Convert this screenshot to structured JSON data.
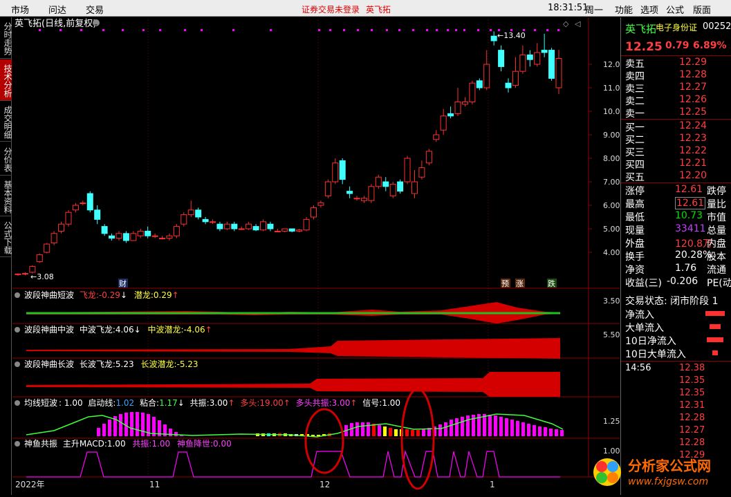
{
  "menubar": {
    "items": [
      "市场",
      "问达",
      "交易"
    ],
    "warning": "证券交易未登录",
    "stock": "英飞拓",
    "time": "18:31:51",
    "weekday": "周一",
    "right": [
      "功能",
      "选项",
      "公式",
      "版面"
    ]
  },
  "sidebar": {
    "tabs": [
      "分时走势",
      "技术分析",
      "成交明细",
      "分价表",
      "基本资料",
      "公式下载"
    ],
    "active": 1
  },
  "main_chart": {
    "title": "英飞拓(日线,前复权)",
    "high_label": "13.40",
    "low_label": "3.08",
    "markers": [
      "财",
      "预",
      "涨",
      "跌"
    ],
    "yaxis": [
      "12.00",
      "11.00",
      "10.00",
      "9.00",
      "8.00",
      "7.00",
      "6.00",
      "5.00",
      "4.00"
    ],
    "xaxis": [
      "2022年",
      "11",
      "12",
      "1"
    ]
  },
  "panels": [
    {
      "name": "波段神曲短波",
      "items": [
        {
          "label": "飞龙:",
          "value": "-0.29",
          "arrow": "↓"
        },
        {
          "label": "潜龙:",
          "value": "0.29",
          "arrow": "↑"
        }
      ],
      "axis": "3.50"
    },
    {
      "name": "波段神曲中波",
      "items": [
        {
          "label": "中波飞龙:",
          "value": "4.06",
          "arrow": "↓"
        },
        {
          "label": "中波潜龙:",
          "value": "-4.06",
          "arrow": "↑"
        }
      ],
      "axis": "5.50"
    },
    {
      "name": "波段神曲长波",
      "items": [
        {
          "label": "长波飞龙:",
          "value": "5.23",
          "arrow": ""
        },
        {
          "label": "长波潜龙:",
          "value": "-5.23",
          "arrow": ""
        }
      ],
      "axis": ""
    },
    {
      "name": "均线短波",
      "items": [
        {
          "label": "",
          "value": ": 1.00",
          "arrow": ""
        },
        {
          "label": "启动线:",
          "value": "1.02",
          "arrow": ""
        },
        {
          "label": "粘合:",
          "value": "1.17",
          "arrow": "↓"
        },
        {
          "label": "共振:",
          "value": "3.00",
          "arrow": "↑"
        },
        {
          "label": "多头:",
          "value": "19.00",
          "arrow": "↑"
        },
        {
          "label": "多头共振:",
          "value": "3.00",
          "arrow": "↑"
        },
        {
          "label": "信号:",
          "value": "1.00",
          "arrow": ""
        }
      ],
      "axis": "1.25"
    },
    {
      "name": "神鱼共振",
      "items": [
        {
          "label": "主升MACD:",
          "value": "1.00",
          "arrow": ""
        },
        {
          "label": "共振:",
          "value": "1.00",
          "arrow": ""
        },
        {
          "label": "神鱼降世:",
          "value": "0.00",
          "arrow": ""
        }
      ],
      "axis": "1.00"
    }
  ],
  "quote": {
    "name": "英飞拓",
    "sub": "电子身份证",
    "code": "00252",
    "price": "12.25",
    "change": "0.79",
    "pct": "6.89%",
    "sell": [
      {
        "label": "卖五",
        "price": "12.29"
      },
      {
        "label": "卖四",
        "price": "12.28"
      },
      {
        "label": "卖三",
        "price": "12.27"
      },
      {
        "label": "卖二",
        "price": "12.26"
      },
      {
        "label": "卖一",
        "price": "12.25"
      }
    ],
    "buy": [
      {
        "label": "买一",
        "price": "12.24"
      },
      {
        "label": "买二",
        "price": "12.23"
      },
      {
        "label": "买三",
        "price": "12.22"
      },
      {
        "label": "买四",
        "price": "12.21"
      },
      {
        "label": "买五",
        "price": "12.20"
      }
    ],
    "stats": [
      {
        "l": "涨停",
        "v": "12.61",
        "r": "跌停",
        "vc": "#ff4040"
      },
      {
        "l": "最高",
        "v": "12.61",
        "r": "量比",
        "vc": "#ff4040",
        "box": true
      },
      {
        "l": "最低",
        "v": "10.73",
        "r": "市值",
        "vc": "#00e000"
      },
      {
        "l": "现量",
        "v": "33411",
        "r": "总量",
        "vc": "#c040ff"
      },
      {
        "l": "外盘",
        "v": "120.8万",
        "r": "内盘",
        "vc": "#ff4040"
      },
      {
        "l": "换手",
        "v": "20.28%",
        "r": "股本",
        "vc": "#fff"
      },
      {
        "l": "净资",
        "v": "1.76",
        "r": "流通",
        "vc": "#fff"
      },
      {
        "l": "收益(三)",
        "v": "-0.206",
        "r": "PE(动",
        "vc": "#fff"
      }
    ],
    "status": "交易状态: 闭市阶段 1",
    "flows": [
      "净流入",
      "大单流入",
      "10日净流入",
      "10日大单流入"
    ],
    "ticks_time": "14:56",
    "ticks": [
      "12.38",
      "12.35",
      "12.35",
      "12.31",
      "12.28",
      "12.27",
      "12.28",
      "12.29"
    ]
  },
  "logo": {
    "title": "分析家公式网",
    "url": "www.fxjgsw.com"
  },
  "chart_data": {
    "type": "candlestick",
    "candles": [
      [
        3.05,
        3.08,
        3.0,
        3.1
      ],
      [
        3.08,
        3.1,
        3.02,
        3.15
      ],
      [
        3.15,
        3.4,
        3.1,
        3.45
      ],
      [
        3.6,
        3.9,
        3.55,
        3.95
      ],
      [
        4.0,
        4.35,
        3.95,
        4.4
      ],
      [
        4.4,
        4.8,
        4.3,
        4.9
      ],
      [
        4.9,
        5.2,
        4.8,
        5.3
      ],
      [
        5.2,
        5.7,
        5.1,
        5.8
      ],
      [
        5.8,
        6.0,
        5.7,
        6.1
      ],
      [
        6.1,
        6.1,
        6.0,
        6.2
      ],
      [
        6.5,
        5.8,
        5.7,
        6.6
      ],
      [
        5.8,
        5.4,
        5.2,
        6.0
      ],
      [
        5.1,
        4.8,
        4.7,
        5.2
      ],
      [
        4.7,
        4.6,
        4.5,
        4.8
      ],
      [
        4.6,
        4.8,
        4.5,
        4.9
      ],
      [
        4.8,
        4.5,
        4.4,
        4.9
      ],
      [
        4.5,
        4.8,
        4.5,
        4.9
      ],
      [
        4.7,
        4.9,
        4.6,
        5.0
      ],
      [
        4.9,
        4.7,
        4.6,
        5.1
      ],
      [
        4.7,
        4.7,
        4.6,
        4.8
      ],
      [
        4.6,
        4.6,
        4.55,
        4.7
      ],
      [
        4.6,
        4.7,
        4.5,
        4.8
      ],
      [
        4.7,
        5.1,
        4.6,
        5.2
      ],
      [
        5.2,
        5.6,
        5.1,
        5.7
      ],
      [
        5.6,
        5.8,
        5.5,
        6.2
      ],
      [
        5.8,
        5.5,
        5.4,
        5.9
      ],
      [
        5.4,
        5.3,
        5.2,
        5.5
      ],
      [
        5.3,
        5.3,
        5.2,
        5.4
      ],
      [
        5.2,
        5.0,
        4.9,
        5.3
      ],
      [
        5.0,
        5.2,
        4.95,
        5.3
      ],
      [
        5.2,
        5.0,
        4.9,
        5.3
      ],
      [
        5.0,
        5.0,
        4.95,
        5.1
      ],
      [
        5.0,
        5.2,
        4.95,
        5.3
      ],
      [
        5.1,
        4.95,
        4.9,
        5.2
      ],
      [
        4.95,
        5.3,
        4.9,
        5.4
      ],
      [
        5.2,
        5.0,
        4.9,
        5.3
      ],
      [
        4.9,
        4.9,
        4.85,
        5.0
      ],
      [
        4.9,
        5.0,
        4.85,
        5.0
      ],
      [
        5.0,
        4.9,
        4.85,
        5.0
      ],
      [
        4.9,
        4.95,
        4.85,
        5.0
      ],
      [
        4.95,
        5.4,
        4.9,
        5.5
      ],
      [
        5.5,
        5.9,
        5.4,
        6.0
      ],
      [
        6.0,
        6.1,
        5.9,
        6.2
      ],
      [
        6.4,
        7.0,
        6.3,
        7.1
      ],
      [
        7.0,
        7.8,
        6.9,
        8.0
      ],
      [
        7.9,
        7.1,
        6.9,
        8.0
      ],
      [
        6.6,
        6.5,
        6.3,
        6.8
      ],
      [
        6.3,
        6.3,
        6.2,
        6.4
      ],
      [
        6.2,
        6.3,
        6.1,
        6.4
      ],
      [
        6.2,
        6.8,
        6.1,
        6.9
      ],
      [
        6.8,
        7.2,
        6.7,
        7.3
      ],
      [
        7.0,
        6.8,
        6.6,
        7.2
      ],
      [
        6.4,
        6.9,
        6.3,
        7.0
      ],
      [
        7.0,
        6.6,
        6.5,
        7.1
      ],
      [
        7.0,
        8.0,
        6.9,
        8.1
      ],
      [
        6.5,
        7.0,
        6.3,
        7.5
      ],
      [
        7.2,
        7.6,
        7.1,
        7.9
      ],
      [
        7.8,
        8.3,
        7.7,
        8.4
      ],
      [
        8.8,
        9.0,
        8.7,
        9.2
      ],
      [
        9.2,
        9.8,
        9.0,
        10.1
      ],
      [
        9.9,
        9.8,
        9.7,
        10.2
      ],
      [
        9.9,
        10.4,
        9.8,
        11.0
      ],
      [
        10.3,
        10.4,
        10.2,
        10.6
      ],
      [
        10.4,
        11.2,
        10.3,
        11.3
      ],
      [
        11.3,
        11.0,
        10.9,
        11.4
      ],
      [
        11.0,
        12.0,
        10.9,
        12.6
      ],
      [
        13.2,
        13.0,
        12.8,
        13.4
      ],
      [
        12.6,
        11.9,
        11.7,
        12.8
      ],
      [
        11.2,
        11.0,
        10.8,
        11.4
      ],
      [
        11.1,
        11.7,
        11.0,
        12.3
      ],
      [
        11.7,
        12.4,
        11.6,
        12.8
      ],
      [
        12.4,
        12.2,
        11.9,
        12.6
      ],
      [
        12.0,
        12.5,
        11.9,
        12.9
      ],
      [
        12.6,
        12.5,
        12.3,
        13.3
      ],
      [
        12.6,
        11.4,
        11.3,
        12.7
      ],
      [
        11.0,
        12.25,
        10.73,
        12.61
      ]
    ]
  }
}
